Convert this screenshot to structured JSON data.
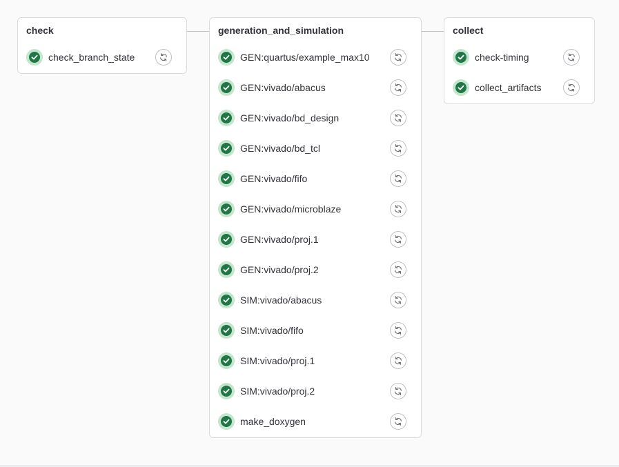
{
  "icons": {
    "status": "status-success-icon",
    "action": "retry-icon"
  },
  "colors": {
    "success": "#217645",
    "success_bg": "#c3e6cd"
  },
  "stages": [
    {
      "title": "check",
      "jobs": [
        "check_branch_state"
      ]
    },
    {
      "title": "generation_and_simulation",
      "jobs": [
        "GEN:quartus/example_max10",
        "GEN:vivado/abacus",
        "GEN:vivado/bd_design",
        "GEN:vivado/bd_tcl",
        "GEN:vivado/fifo",
        "GEN:vivado/microblaze",
        "GEN:vivado/proj.1",
        "GEN:vivado/proj.2",
        "SIM:vivado/abacus",
        "SIM:vivado/fifo",
        "SIM:vivado/proj.1",
        "SIM:vivado/proj.2",
        "make_doxygen"
      ]
    },
    {
      "title": "collect",
      "jobs": [
        "check-timing",
        "collect_artifacts"
      ]
    }
  ]
}
